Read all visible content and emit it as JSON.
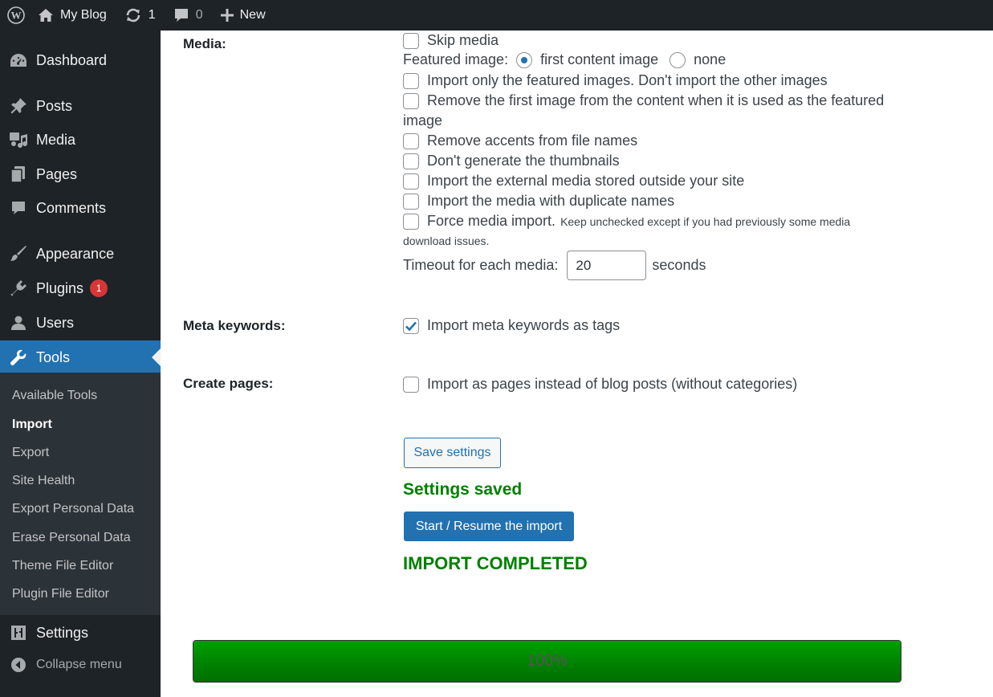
{
  "adminbar": {
    "site_name": "My Blog",
    "updates_count": "1",
    "comments_count": "0",
    "new_label": "New"
  },
  "sidebar": {
    "items": [
      {
        "label": "Dashboard",
        "icon": "dashboard-icon"
      },
      {
        "label": "Posts",
        "icon": "pushpin-icon"
      },
      {
        "label": "Media",
        "icon": "media-icon"
      },
      {
        "label": "Pages",
        "icon": "pages-icon"
      },
      {
        "label": "Comments",
        "icon": "comment-icon"
      },
      {
        "label": "Appearance",
        "icon": "brush-icon"
      },
      {
        "label": "Plugins",
        "icon": "plugin-icon",
        "badge": "1"
      },
      {
        "label": "Users",
        "icon": "user-icon"
      },
      {
        "label": "Tools",
        "icon": "wrench-icon",
        "current": true
      },
      {
        "label": "Settings",
        "icon": "settings-icon"
      }
    ],
    "submenu": [
      "Available Tools",
      "Import",
      "Export",
      "Site Health",
      "Export Personal Data",
      "Erase Personal Data",
      "Theme File Editor",
      "Plugin File Editor"
    ],
    "submenu_current": "Import",
    "collapse_label": "Collapse menu"
  },
  "media": {
    "label": "Media:",
    "skip_media": "Skip media",
    "featured_image_label": "Featured image:",
    "featured_options": [
      "first content image",
      "none"
    ],
    "featured_selected": "first content image",
    "import_only_featured": "Import only the featured images. Don't import the other images",
    "remove_first_image_line1": "Remove the first image from the content when it is used as the featured",
    "remove_first_image_line2": "image",
    "remove_accents": "Remove accents from file names",
    "dont_generate_thumbnails": "Don't generate the thumbnails",
    "import_external": "Import the external media stored outside your site",
    "import_duplicate": "Import the media with duplicate names",
    "force_import": "Force media import.",
    "force_import_note_line1": "Keep unchecked except if you had previously some media",
    "force_import_note_line2": "download issues.",
    "timeout_label": "Timeout for each media:",
    "timeout_value": "20",
    "timeout_unit": "seconds"
  },
  "meta_keywords": {
    "label": "Meta keywords:",
    "option": "Import meta keywords as tags",
    "checked": true
  },
  "create_pages": {
    "label": "Create pages:",
    "option": "Import as pages instead of blog posts (without categories)",
    "checked": false
  },
  "actions": {
    "save_settings": "Save settings",
    "settings_saved": "Settings saved",
    "start_import": "Start / Resume the import",
    "import_completed": "IMPORT COMPLETED"
  },
  "progress": {
    "percent": 100,
    "label": "100%"
  },
  "colors": {
    "admin_bg": "#1d2327",
    "accent": "#2271b1",
    "success": "#008000",
    "badge": "#d63638"
  }
}
